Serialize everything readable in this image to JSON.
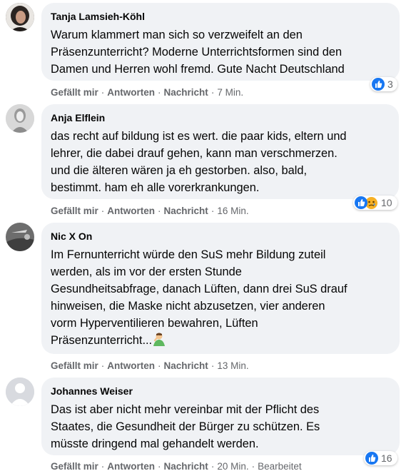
{
  "comments": [
    {
      "author": "Tanja Lamsieh-Köhl",
      "text": "Warum klammert man sich so verzweifelt an den\nPräsenzunterricht? Moderne Unterrichtsformen sind den\nDamen und Herren wohl fremd. Gute Nacht Deutschland",
      "like_label": "Gefällt mir",
      "reply_label": "Antworten",
      "message_label": "Nachricht",
      "time": "7 Min.",
      "reaction_count": "3",
      "reactions": [
        "like-icon"
      ]
    },
    {
      "author": "Anja Elflein",
      "text": "das recht auf bildung ist es wert. die paar kids, eltern und\nlehrer, die dabei drauf gehen, kann man verschmerzen.\nund die älteren wären ja eh gestorben. also, bald,\nbestimmt. ham eh alle vorerkrankungen.",
      "like_label": "Gefällt mir",
      "reply_label": "Antworten",
      "message_label": "Nachricht",
      "time": "16 Min.",
      "reaction_count": "10",
      "reactions": [
        "like-icon",
        "sad-icon"
      ]
    },
    {
      "author": "Nic X On",
      "text": "Im Fernunterricht würde den SuS mehr Bildung zuteil\nwerden, als im vor der ersten Stunde\nGesundheitsabfrage, danach Lüften, dann drei SuS drauf\nhinweisen, die Maske nicht abzusetzen, vier anderen\nvorm Hyperventilieren bewahren, Lüften\nPräsenzunterricht...",
      "like_label": "Gefällt mir",
      "reply_label": "Antworten",
      "message_label": "Nachricht",
      "time": "13 Min.",
      "trailing_emoji": "facepalm-emoji"
    },
    {
      "author": "Johannes Weiser",
      "text": "Das ist aber nicht mehr vereinbar mit der Pflicht des\nStaates, die Gesundheit der Bürger zu schützen. Es\nmüsste dringend mal gehandelt werden.",
      "like_label": "Gefällt mir",
      "reply_label": "Antworten",
      "message_label": "Nachricht",
      "time": "20 Min.",
      "edited": "Bearbeitet",
      "reaction_count": "16",
      "reactions": [
        "like-icon"
      ]
    }
  ],
  "colors": {
    "bubble": "#f0f2f5",
    "like": "#1877f2",
    "sad": "#f7b125",
    "meta": "#65676b"
  }
}
